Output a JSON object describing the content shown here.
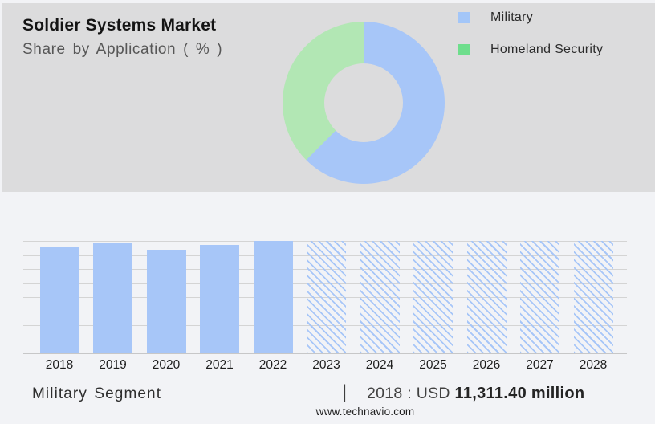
{
  "header": {
    "title": "Soldier Systems Market",
    "subtitle": "Share by Application ( % )"
  },
  "colors": {
    "top_panel_bg": "#dcdcdd",
    "bottom_panel_bg": "#f2f3f6",
    "bar_blue": "#a7c6f8",
    "donut_blue": "#a7c6f8",
    "donut_green": "#b2e7b4",
    "legend_blue": "#a3c6f8",
    "legend_green": "#6ede8c",
    "gridline": "#d4d4d4",
    "axis": "#c7c7c8"
  },
  "caption": {
    "segment_label": "Military Segment",
    "separator": "|",
    "value_prefix": "2018 : USD ",
    "value_bold": "11,311.40 million"
  },
  "footer": {
    "website": "www.technavio.com"
  },
  "chart_data": [
    {
      "type": "pie",
      "subtype": "donut",
      "title": "Soldier Systems Market — Share by Application ( % )",
      "labels": [
        "Military",
        "Homeland Security"
      ],
      "values": [
        62.5,
        37.5
      ],
      "slice_colors": [
        "#a7c6f8",
        "#b2e7b4"
      ],
      "legend_swatch_colors": [
        "#a3c6f8",
        "#6ede8c"
      ],
      "legend_position": "right",
      "start_angle_deg": 0,
      "direction": "clockwise",
      "inner_radius_pct": 48.5
    },
    {
      "type": "bar",
      "title": "Military Segment",
      "categories": [
        "2018",
        "2019",
        "2020",
        "2021",
        "2022",
        "2023",
        "2024",
        "2025",
        "2026",
        "2027",
        "2028"
      ],
      "values_pct_of_max": [
        95,
        97.9,
        92.1,
        96.4,
        100,
        100,
        100,
        100,
        100,
        100,
        100
      ],
      "hatched_forecast_from": "2023",
      "annotation": "2018 : USD 11,311.40 million",
      "grid": true,
      "gridline_count": 8,
      "y_axis_labels_shown": false,
      "ylim_pct": [
        0,
        100
      ]
    }
  ]
}
